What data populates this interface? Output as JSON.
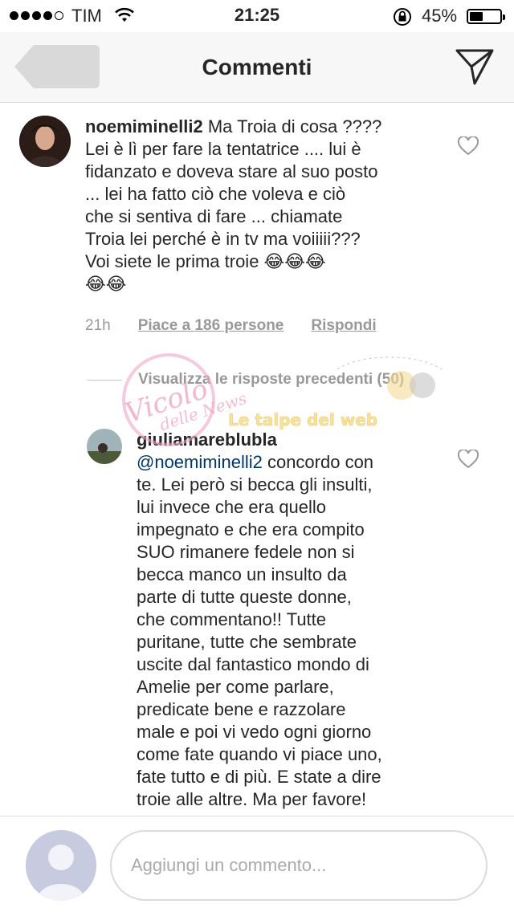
{
  "status_bar": {
    "carrier": "TIM",
    "time": "21:25",
    "battery": "45%",
    "battery_level": 0.45
  },
  "nav": {
    "title": "Commenti",
    "back_icon": "back-arrow-icon",
    "direct_icon": "paper-plane-icon"
  },
  "comments": [
    {
      "username": "noemiminelli2",
      "lines": [
        "Ma Troia di cosa ????",
        "Lei è lì per fare la tentatrice .... lui è",
        "fidanzato e doveva stare al suo posto",
        "... lei ha fatto ciò che voleva e ciò",
        "che si sentiva di fare ... chiamate",
        "Troia lei perché è in tv ma voiiiii???",
        "Voi siete le prima troie 😂😂😂",
        "😂😂"
      ],
      "time_ago": "21h",
      "likes": "Piace a 186 persone",
      "reply": "Rispondi"
    }
  ],
  "replies_toggle": "Visualizza le risposte precedenti (50)",
  "reply": {
    "username": "giuliamareblubla",
    "mention": "@noemiminelli2",
    "first_line_rest": " concordo con",
    "lines": [
      "te. Lei però si becca gli insulti,",
      "lui invece che era quello",
      "impegnato e che era compito",
      "SUO rimanere fedele non si",
      "becca manco un insulto da",
      "parte di tutte queste donne,",
      "che commentano!! Tutte",
      "puritane, tutte che sembrate",
      "uscite dal fantastico mondo di",
      "Amelie per come parlare,",
      "predicate bene e razzolare",
      "male e poi vi vedo ogni giorno",
      "come fate quando vi piace uno,",
      "fate tutto e di più. E state a dire",
      "troie alle altre. Ma per favore!"
    ]
  },
  "watermark": {
    "left": "Vicolo delle News",
    "right": "Le talpe del web"
  },
  "composer": {
    "placeholder": "Aggiungi un commento..."
  }
}
